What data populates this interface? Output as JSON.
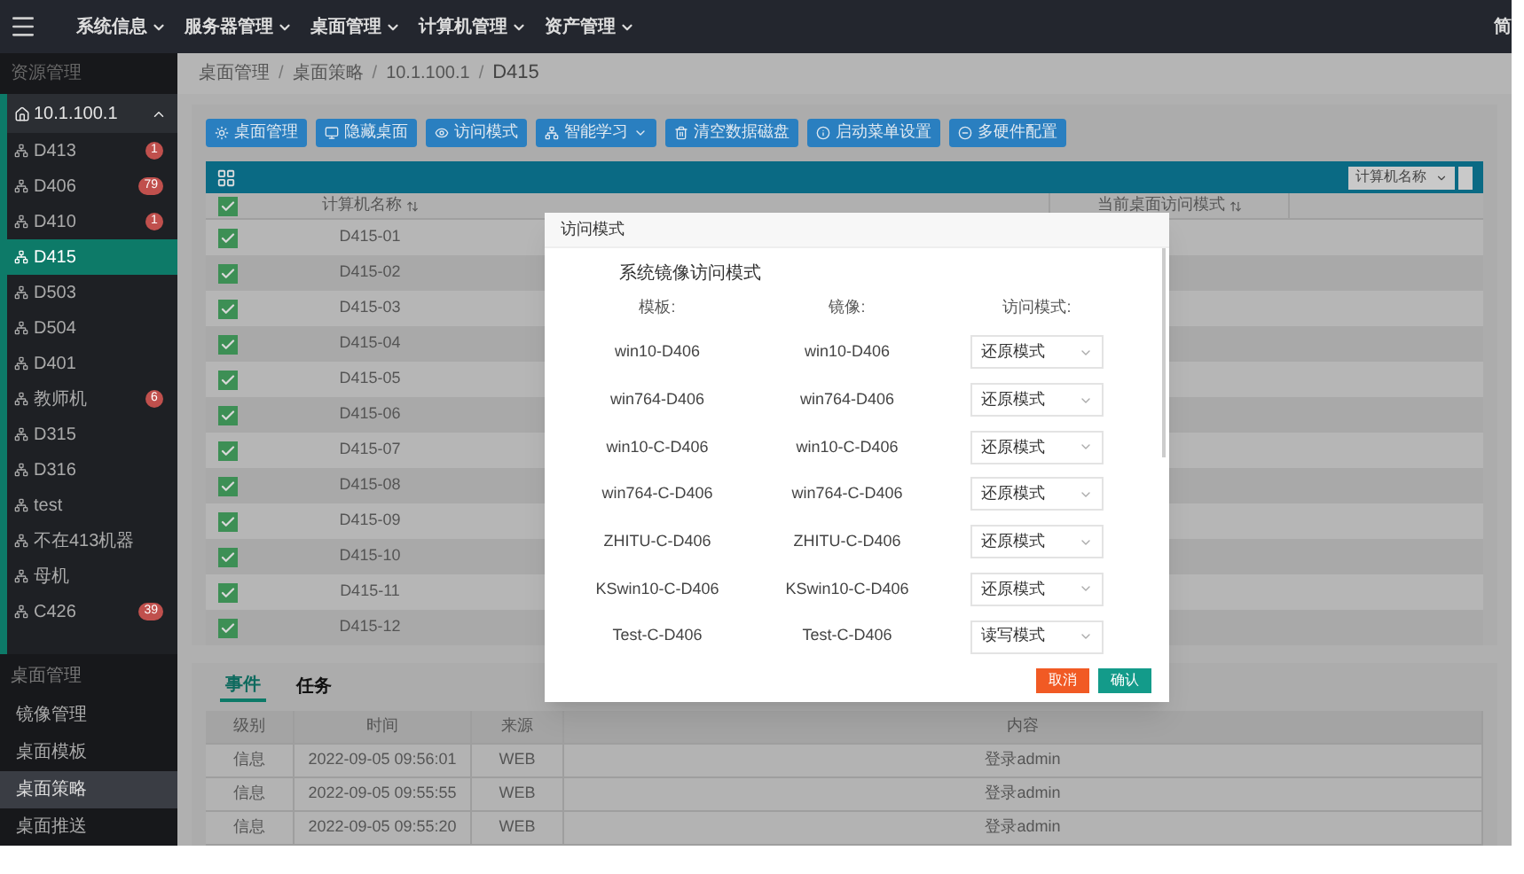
{
  "top_nav": {
    "menu": [
      "系统信息",
      "服务器管理",
      "桌面管理",
      "计算机管理",
      "资产管理"
    ],
    "right_text": "简"
  },
  "sidebar": {
    "section_title": "资源管理",
    "root": {
      "label": "10.1.100.1",
      "expanded": true,
      "children": [
        {
          "label": "D413",
          "badge": "1",
          "selected": false
        },
        {
          "label": "D406",
          "badge": "79",
          "selected": false
        },
        {
          "label": "D410",
          "badge": "1",
          "selected": false
        },
        {
          "label": "D415",
          "selected": true
        },
        {
          "label": "D503",
          "selected": false
        },
        {
          "label": "D504",
          "selected": false
        },
        {
          "label": "D401",
          "selected": false
        },
        {
          "label": "教师机",
          "badge": "6",
          "selected": false
        },
        {
          "label": "D315",
          "selected": false
        },
        {
          "label": "D316",
          "selected": false
        },
        {
          "label": "test",
          "selected": false
        },
        {
          "label": "不在413机器",
          "selected": false
        },
        {
          "label": "母机",
          "selected": false
        },
        {
          "label": "C426",
          "badge": "39",
          "selected": false
        }
      ]
    },
    "section2_title": "桌面管理",
    "section2_items": [
      {
        "label": "镜像管理",
        "selected": false
      },
      {
        "label": "桌面模板",
        "selected": false
      },
      {
        "label": "桌面策略",
        "selected": true
      },
      {
        "label": "桌面推送",
        "selected": false
      }
    ]
  },
  "breadcrumb": [
    "桌面管理",
    "桌面策略",
    "10.1.100.1",
    "D415"
  ],
  "breadcrumb_separator": "/",
  "toolbar": [
    {
      "label": "桌面管理",
      "kind": "sun"
    },
    {
      "label": "隐藏桌面",
      "kind": "monitor"
    },
    {
      "label": "访问模式",
      "kind": "eye"
    },
    {
      "label": "智能学习",
      "kind": "dropdown"
    },
    {
      "label": "清空数据磁盘",
      "kind": "trash"
    },
    {
      "label": "启动菜单设置",
      "kind": "info"
    },
    {
      "label": "多硬件配置",
      "kind": "minus"
    }
  ],
  "table": {
    "filter": "计算机名称",
    "header_checked": true,
    "columns": [
      "计算机名称",
      "当前桌面访问模式"
    ],
    "rows": [
      {
        "name": "D415-01",
        "checked": true
      },
      {
        "name": "D415-02",
        "checked": true
      },
      {
        "name": "D415-03",
        "checked": true
      },
      {
        "name": "D415-04",
        "checked": true
      },
      {
        "name": "D415-05",
        "checked": true
      },
      {
        "name": "D415-06",
        "checked": true
      },
      {
        "name": "D415-07",
        "checked": true
      },
      {
        "name": "D415-08",
        "checked": true
      },
      {
        "name": "D415-09",
        "checked": true
      },
      {
        "name": "D415-10",
        "checked": true
      },
      {
        "name": "D415-11",
        "checked": true
      },
      {
        "name": "D415-12",
        "checked": true
      }
    ]
  },
  "modal": {
    "title": "访问模式",
    "heading": "系统镜像访问模式",
    "columns": [
      "模板:",
      "镜像:",
      "访问模式:"
    ],
    "rows": [
      {
        "template": "win10-D406",
        "image": "win10-D406",
        "mode": "还原模式"
      },
      {
        "template": "win764-D406",
        "image": "win764-D406",
        "mode": "还原模式"
      },
      {
        "template": "win10-C-D406",
        "image": "win10-C-D406",
        "mode": "还原模式"
      },
      {
        "template": "win764-C-D406",
        "image": "win764-C-D406",
        "mode": "还原模式"
      },
      {
        "template": "ZHITU-C-D406",
        "image": "ZHITU-C-D406",
        "mode": "还原模式"
      },
      {
        "template": "KSwin10-C-D406",
        "image": "KSwin10-C-D406",
        "mode": "还原模式"
      },
      {
        "template": "Test-C-D406",
        "image": "Test-C-D406",
        "mode": "读写模式"
      }
    ],
    "buttons": [
      {
        "label": "取消",
        "kind": "cancel"
      },
      {
        "label": "确认",
        "kind": "confirm"
      }
    ]
  },
  "log": {
    "tabs": [
      {
        "label": "事件",
        "selected": true
      },
      {
        "label": "任务",
        "selected": false
      }
    ],
    "columns": [
      "级别",
      "时间",
      "来源",
      "内容"
    ],
    "rows": [
      [
        "信息",
        "2022-09-05 09:56:01",
        "WEB",
        "登录admin"
      ],
      [
        "信息",
        "2022-09-05 09:55:55",
        "WEB",
        "登录admin"
      ],
      [
        "信息",
        "2022-09-05 09:55:20",
        "WEB",
        "登录admin"
      ]
    ]
  }
}
